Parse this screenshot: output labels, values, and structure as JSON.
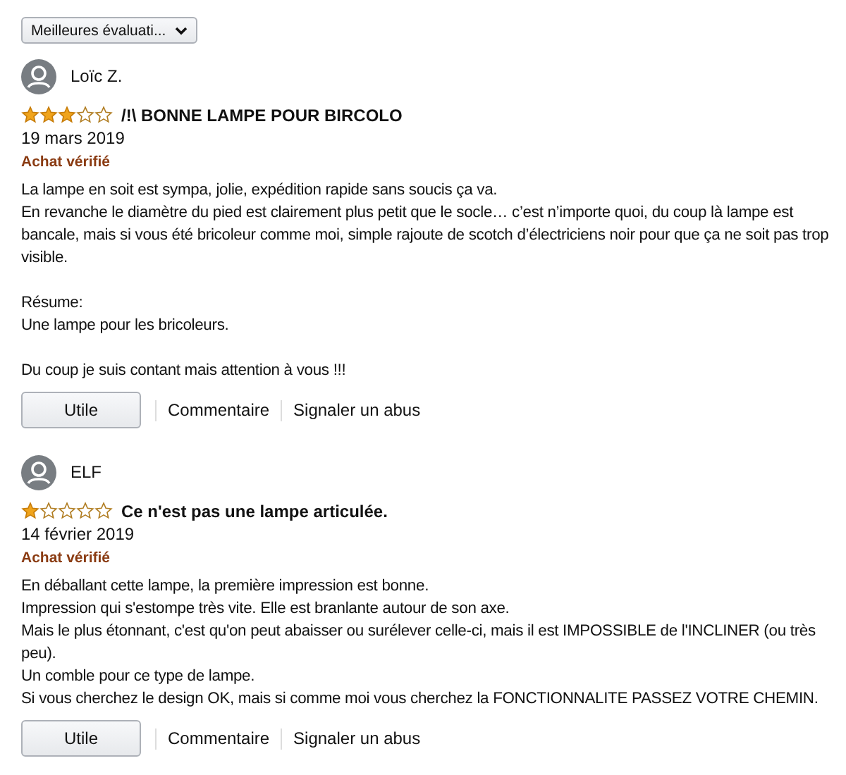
{
  "sort_dropdown": {
    "value": "Meilleures évaluati..."
  },
  "reviews": [
    {
      "author": "Loïc Z.",
      "stars": 3,
      "title": "/!\\ BONNE LAMPE POUR BIRCOLO",
      "date": "19 mars 2019",
      "badge": "Achat vérifié",
      "paragraphs": [
        [
          "La lampe en soit est sympa, jolie, expédition rapide sans soucis ça va.",
          "En revanche le diamètre du pied est clairement plus petit que le socle… c’est n’importe quoi, du coup là lampe est bancale, mais si vous été bricoleur comme moi, simple rajoute de scotch d’électriciens noir pour que ça ne soit pas trop visible."
        ],
        [
          "Résume:",
          "Une lampe pour les bricoleurs."
        ],
        [
          "Du coup je suis contant mais attention à vous !!!"
        ]
      ],
      "actions": {
        "helpful": "Utile",
        "comment": "Commentaire",
        "report": "Signaler un abus"
      }
    },
    {
      "author": "ELF",
      "stars": 1,
      "title": "Ce n'est pas une lampe articulée.",
      "date": "14 février 2019",
      "badge": "Achat vérifié",
      "paragraphs": [
        [
          "En déballant cette lampe, la première impression est bonne.",
          "Impression qui s'estompe très vite. Elle est branlante autour de son axe.",
          "Mais le plus étonnant, c'est qu'on peut abaisser ou surélever celle-ci, mais il est IMPOSSIBLE de l'INCLINER (ou très peu).",
          "Un comble pour ce type de lampe.",
          "Si vous cherchez le design OK, mais si comme moi vous cherchez la FONCTIONNALITE PASSEZ VOTRE CHEMIN."
        ]
      ],
      "actions": {
        "helpful": "Utile",
        "comment": "Commentaire",
        "report": "Signaler un abus"
      }
    }
  ]
}
